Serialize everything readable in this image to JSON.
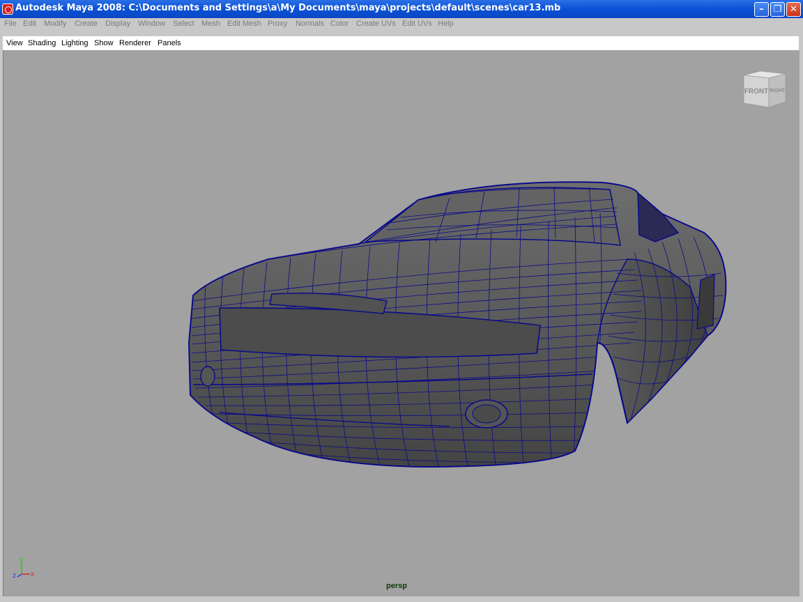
{
  "window": {
    "title": "Autodesk Maya 2008: C:\\Documents and Settings\\a\\My Documents\\maya\\projects\\default\\scenes\\car13.mb",
    "minimize_icon": "minimize-icon",
    "maximize_icon": "restore-icon",
    "close_icon": "close-icon"
  },
  "menubar": {
    "items": [
      "File",
      "Edit",
      "Modify",
      "Create",
      "Display",
      "Window",
      "Select",
      "Mesh",
      "Edit Mesh",
      "Proxy",
      "Normals",
      "Color",
      "Create UVs",
      "Edit UVs",
      "Help"
    ]
  },
  "panel_menu": {
    "items": [
      "View",
      "Shading",
      "Lighting",
      "Show",
      "Renderer",
      "Panels"
    ]
  },
  "viewport": {
    "camera_label": "persp",
    "background": "#a2a2a2",
    "wire_color": "#0a0a8a",
    "viewcube": {
      "front": "FRONT",
      "right": "RIGHT"
    },
    "axes": {
      "x": "x",
      "y": "y",
      "z": "z"
    }
  }
}
